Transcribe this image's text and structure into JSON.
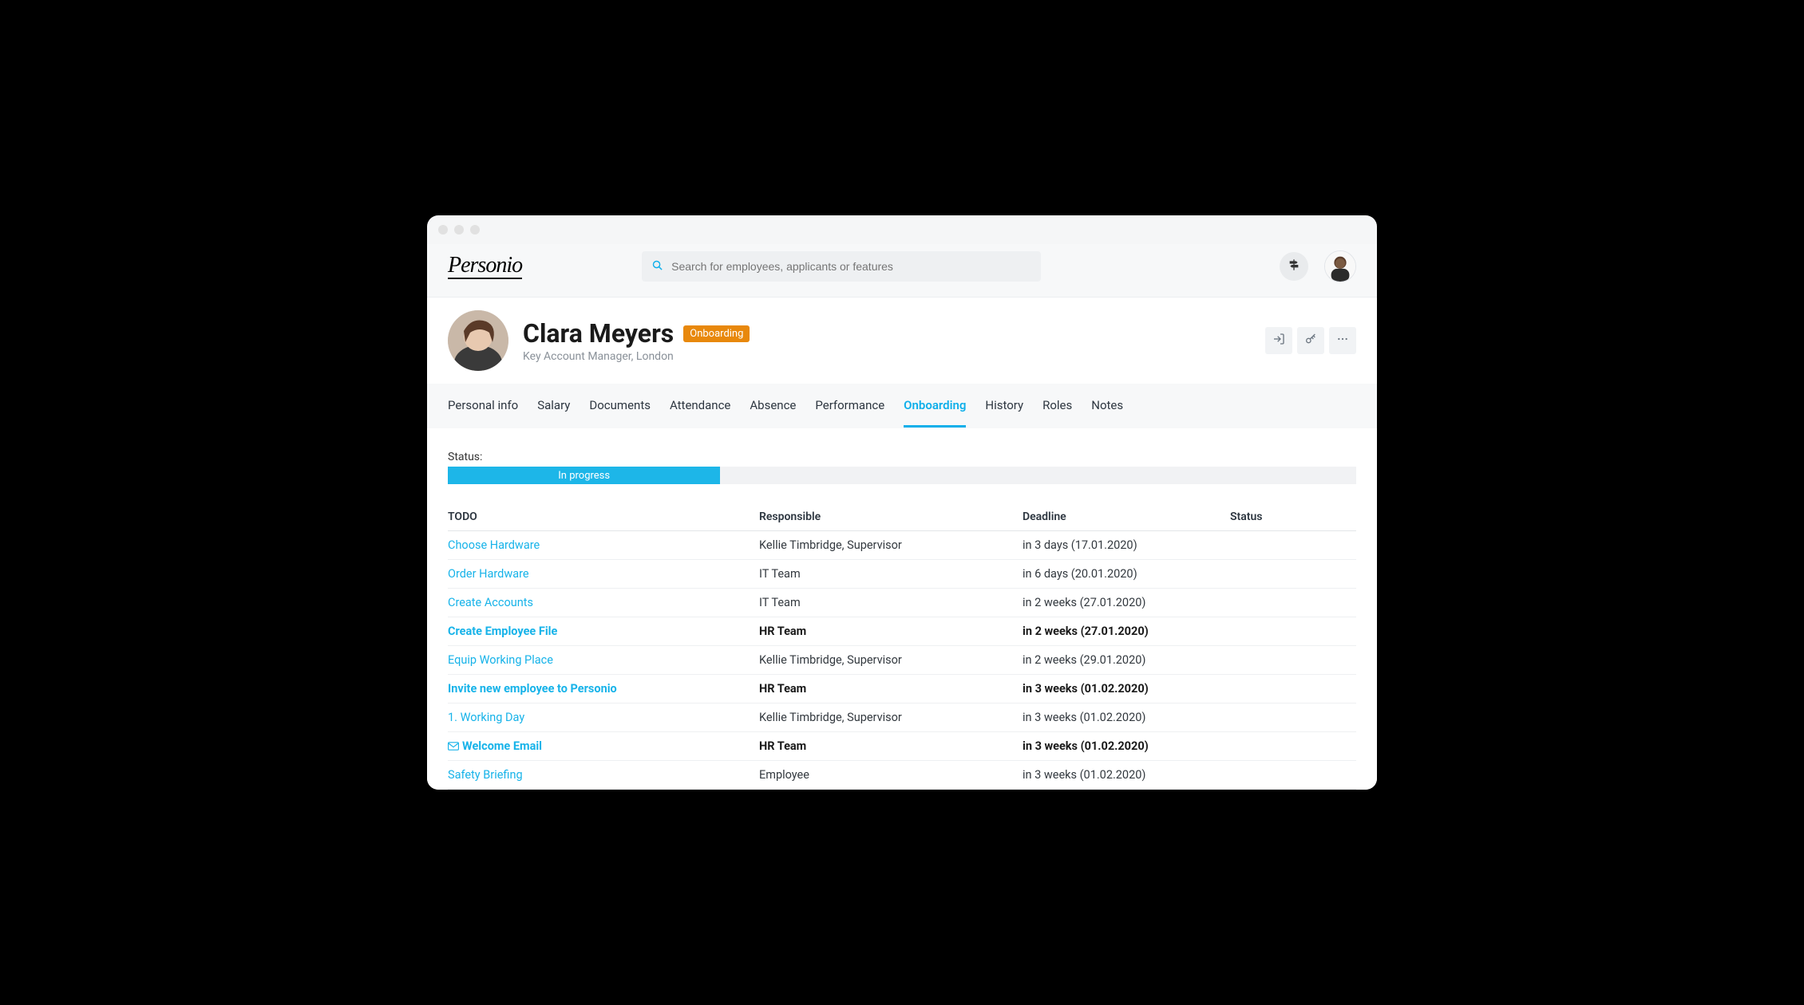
{
  "brand": "Personio",
  "search": {
    "placeholder": "Search for employees, applicants or features"
  },
  "profile": {
    "name": "Clara Meyers",
    "badge": "Onboarding",
    "subtitle": "Key Account Manager, London"
  },
  "tabs": [
    {
      "label": "Personal info"
    },
    {
      "label": "Salary"
    },
    {
      "label": "Documents"
    },
    {
      "label": "Attendance"
    },
    {
      "label": "Absence"
    },
    {
      "label": "Performance"
    },
    {
      "label": "Onboarding",
      "active": true
    },
    {
      "label": "History"
    },
    {
      "label": "Roles"
    },
    {
      "label": "Notes"
    }
  ],
  "status": {
    "label": "Status:",
    "text": "In progress",
    "percent": 30
  },
  "table": {
    "headers": {
      "todo": "TODO",
      "responsible": "Responsible",
      "deadline": "Deadline",
      "status": "Status"
    },
    "rows": [
      {
        "todo": "Choose Hardware",
        "responsible": "Kellie Timbridge, Supervisor",
        "deadline": "in 3 days (17.01.2020)",
        "status": "green",
        "bold": false,
        "icon": null
      },
      {
        "todo": "Order Hardware",
        "responsible": "IT Team",
        "deadline": "in 6 days (20.01.2020)",
        "status": "green",
        "bold": false,
        "icon": null
      },
      {
        "todo": "Create Accounts",
        "responsible": "IT Team",
        "deadline": "in 2 weeks (27.01.2020)",
        "status": "green",
        "bold": false,
        "icon": null
      },
      {
        "todo": "Create Employee File",
        "responsible": "HR Team",
        "deadline": "in 2 weeks (27.01.2020)",
        "status": "orange",
        "bold": true,
        "icon": null
      },
      {
        "todo": "Equip Working Place",
        "responsible": "Kellie Timbridge, Supervisor",
        "deadline": "in 2 weeks (29.01.2020)",
        "status": "orange",
        "bold": false,
        "icon": null
      },
      {
        "todo": "Invite new employee to Personio",
        "responsible": "HR Team",
        "deadline": "in 3 weeks (01.02.2020)",
        "status": "orange",
        "bold": true,
        "icon": null
      },
      {
        "todo": "1. Working Day",
        "responsible": "Kellie Timbridge, Supervisor",
        "deadline": "in 3 weeks (01.02.2020)",
        "status": "orange",
        "bold": false,
        "icon": null
      },
      {
        "todo": "Welcome Email",
        "responsible": "HR Team",
        "deadline": "in 3 weeks (01.02.2020)",
        "status": "orange",
        "bold": true,
        "icon": "envelope"
      },
      {
        "todo": "Safety Briefing",
        "responsible": "Employee",
        "deadline": "in 3 weeks (01.02.2020)",
        "status": "orange",
        "bold": false,
        "icon": null
      }
    ]
  }
}
